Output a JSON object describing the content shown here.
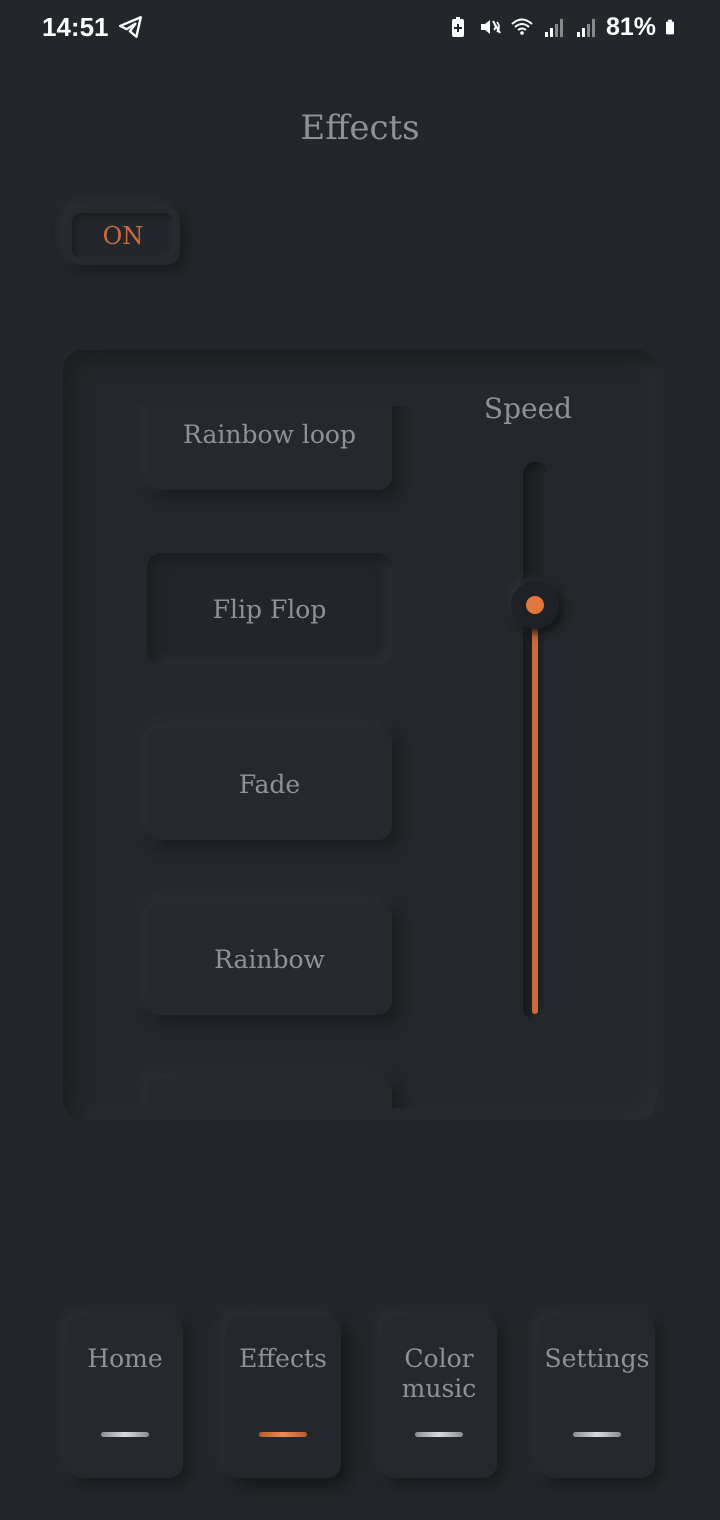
{
  "status_bar": {
    "time": "14:51",
    "battery_percent": "81%",
    "icons": [
      "telegram-icon",
      "battery-saver-icon",
      "vibrate-mute-icon",
      "wifi-icon",
      "signal-1-icon",
      "signal-2-icon",
      "battery-icon"
    ]
  },
  "header": {
    "title": "Effects"
  },
  "power": {
    "label": "ON",
    "state": true,
    "color": "#d06a3a"
  },
  "effects": {
    "items": [
      {
        "label": "Rainbow loop"
      },
      {
        "label": "Flip Flop",
        "selected": true
      },
      {
        "label": "Fade"
      },
      {
        "label": "Rainbow"
      },
      {
        "label": ""
      }
    ]
  },
  "speed": {
    "label": "Speed",
    "value": 0.75
  },
  "nav": {
    "items": [
      {
        "label": "Home",
        "active": false
      },
      {
        "label": "Effects",
        "active": true
      },
      {
        "label": "Color music",
        "active": false
      },
      {
        "label": "Settings",
        "active": false
      }
    ]
  },
  "colors": {
    "background": "#23272b",
    "accent": "#d06a3a",
    "text": "#8e9296"
  }
}
